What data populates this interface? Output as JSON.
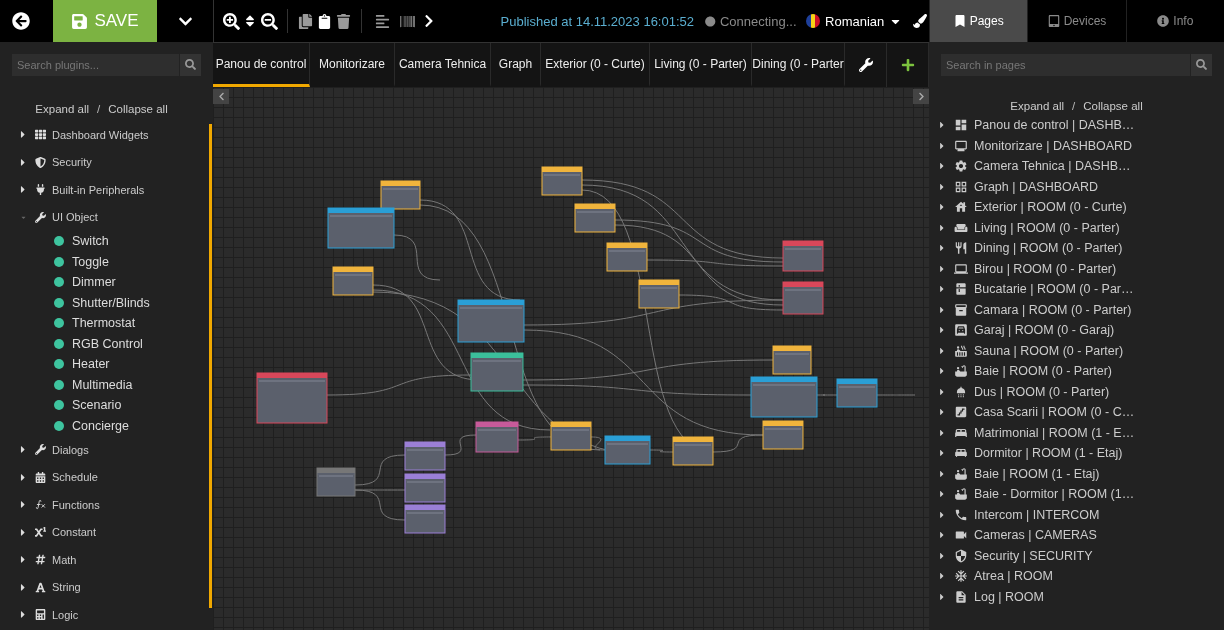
{
  "toolbar": {
    "save_label": "SAVE",
    "published": "Published at 14.11.2023 16:01:52",
    "connection": "Connecting...",
    "language": "Romanian"
  },
  "plugins": {
    "search_placeholder": "Search plugins...",
    "expand_all": "Expand all",
    "separator": "/",
    "collapse_all": "Collapse all",
    "tree": [
      {
        "label": "Dashboard Widgets",
        "expanded": false
      },
      {
        "label": "Security",
        "expanded": false
      },
      {
        "label": "Built-in Peripherals",
        "expanded": false
      },
      {
        "label": "UI Object",
        "expanded": true,
        "children": [
          {
            "label": "Switch"
          },
          {
            "label": "Toggle"
          },
          {
            "label": "Dimmer"
          },
          {
            "label": "Shutter/Blinds"
          },
          {
            "label": "Thermostat"
          },
          {
            "label": "RGB Control"
          },
          {
            "label": "Heater"
          },
          {
            "label": "Multimedia"
          },
          {
            "label": "Scenario"
          },
          {
            "label": "Concierge"
          }
        ]
      },
      {
        "label": "Dialogs",
        "expanded": false
      },
      {
        "label": "Schedule",
        "expanded": false
      },
      {
        "label": "Functions",
        "expanded": false
      },
      {
        "label": "Constant",
        "expanded": false
      },
      {
        "label": "Math",
        "expanded": false
      },
      {
        "label": "String",
        "expanded": false
      },
      {
        "label": "Logic",
        "expanded": false
      }
    ]
  },
  "page_tabs": [
    {
      "label": "Panou de control",
      "selected": true
    },
    {
      "label": "Monitorizare",
      "selected": false
    },
    {
      "label": "Camera Tehnica",
      "selected": false
    },
    {
      "label": "Graph",
      "selected": false
    },
    {
      "label": "Exterior (0 - Curte)",
      "selected": false
    },
    {
      "label": "Living (0 - Parter)",
      "selected": false
    },
    {
      "label": "Dining (0 - Parter",
      "selected": false
    }
  ],
  "right_tabs": [
    {
      "label": "Pages",
      "selected": true
    },
    {
      "label": "Devices",
      "selected": false
    },
    {
      "label": "Info",
      "selected": false
    }
  ],
  "pages": {
    "search_placeholder": "Search in pages",
    "expand_all": "Expand all",
    "separator": "/",
    "collapse_all": "Collapse all",
    "items": [
      {
        "label": "Panou de control | DASHB…"
      },
      {
        "label": "Monitorizare | DASHBOARD"
      },
      {
        "label": "Camera Tehnica | DASHB…"
      },
      {
        "label": "Graph | DASHBOARD"
      },
      {
        "label": "Exterior | ROOM (0 - Curte)"
      },
      {
        "label": "Living | ROOM (0 - Parter)"
      },
      {
        "label": "Dining | ROOM (0 - Parter)"
      },
      {
        "label": "Birou | ROOM (0 - Parter)"
      },
      {
        "label": "Bucatarie | ROOM (0 - Par…"
      },
      {
        "label": "Camara | ROOM (0 - Parter)"
      },
      {
        "label": "Garaj | ROOM (0 - Garaj)"
      },
      {
        "label": "Sauna | ROOM (0 - Parter)"
      },
      {
        "label": "Baie | ROOM (0 - Parter)"
      },
      {
        "label": "Dus | ROOM (0 - Parter)"
      },
      {
        "label": "Casa Scarii | ROOM (0 - C…"
      },
      {
        "label": "Matrimonial | ROOM (1 - E…"
      },
      {
        "label": "Dormitor | ROOM (1 - Etaj)"
      },
      {
        "label": "Baie | ROOM (1 - Etaj)"
      },
      {
        "label": "Baie - Dormitor | ROOM (1…"
      },
      {
        "label": "Intercom | INTERCOM"
      },
      {
        "label": "Cameras | CAMERAS"
      },
      {
        "label": "Security | SECURITY"
      },
      {
        "label": "Atrea | ROOM"
      },
      {
        "label": "Log | ROOM"
      }
    ]
  }
}
